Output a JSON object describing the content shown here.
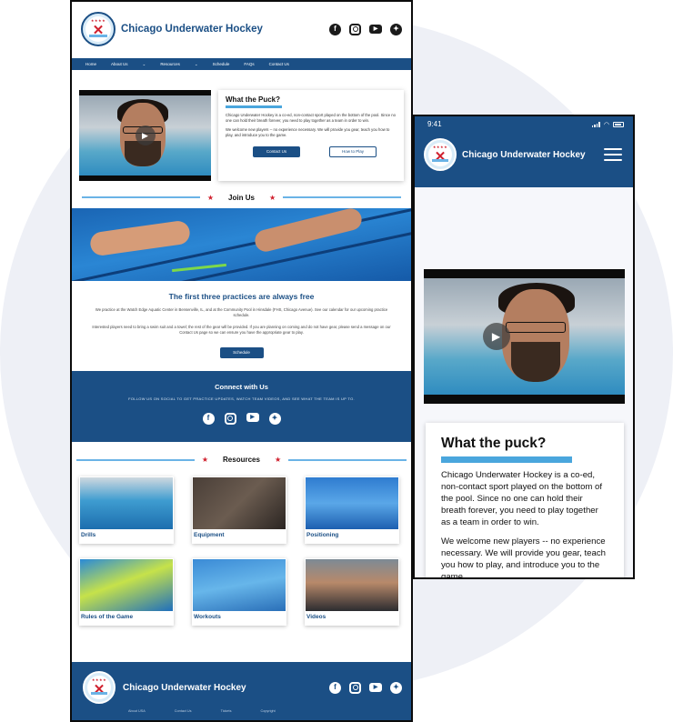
{
  "desktop": {
    "brand": "Chicago Underwater Hockey",
    "nav": [
      "Home",
      "About Us",
      "⌄",
      "Resources",
      "⌄",
      "Schedule",
      "FAQs",
      "Contact Us"
    ],
    "puck_card": {
      "title": "What the Puck?",
      "p1": "Chicago Underwater Hockey is a co-ed, non-contact sport played on the bottom of the pool. Since no one can hold their breath forever, you need to play together as a team in order to win.",
      "p2": "We welcome new players -- no experience necessary. We will provide you gear, teach you how to play, and introduce you to the game.",
      "btn_contact": "Contact Us",
      "btn_how": "How to Play"
    },
    "join": {
      "heading": "Join Us",
      "subheading": "The first three practices are always free",
      "p1": "We practice at the Watch Edge Aquatic Center in Bensenville, IL, and at the Community Pool in Hinsdale (FHS, Chicago Avenue). See our calendar for our upcoming practice schedule.",
      "p2": "Interested players need to bring a swim suit and a towel; the rest of the gear will be provided. If you are planning on coming and do not have gear, please send a message on our Contact Us page so we can ensure you have the appropriate gear to play.",
      "btn_schedule": "Schedule"
    },
    "connect": {
      "heading": "Connect with Us",
      "text": "FOLLOW US ON SOCIAL TO GET PRACTICE UPDATES, WATCH TEAM VIDEOS, AND SEE WHAT THE TEAM IS UP TO."
    },
    "resources": {
      "heading": "Resources",
      "items": [
        "Drills",
        "Equipment",
        "Positioning",
        "Rules of the Game",
        "Workouts",
        "Videos"
      ]
    },
    "footer": {
      "brand": "Chicago Underwater Hockey",
      "links": [
        "About USA",
        "Contact Us",
        "Tickets",
        "Copyright"
      ]
    },
    "social": [
      "f",
      "",
      "▶",
      "✦"
    ]
  },
  "mobile": {
    "time": "9:41",
    "brand": "Chicago Underwater Hockey",
    "card_title": "What the puck?",
    "p1": "Chicago Underwater Hockey is a co-ed, non-contact sport played on the bottom of the pool. Since no one can hold their breath forever, you need to play together as a team in order to win.",
    "p2": "We welcome new players -- no experience necessary. We will provide you gear, teach you how to play, and introduce you to the game."
  },
  "colors": {
    "primary": "#1b4f85",
    "accent": "#4aa6dd",
    "star": "#d0202e",
    "background": "#eef0f6"
  }
}
